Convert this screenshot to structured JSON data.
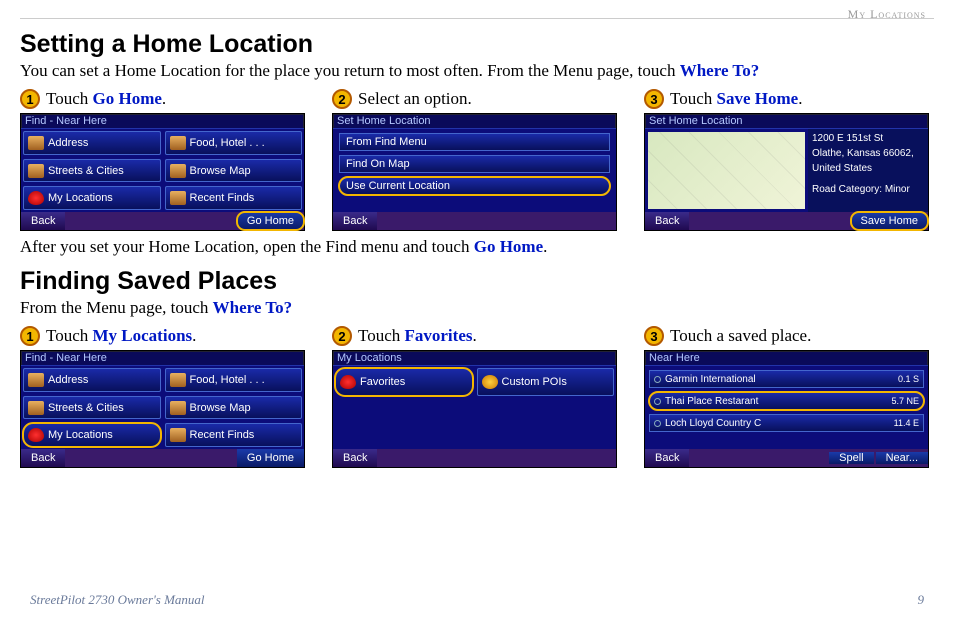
{
  "header": {
    "section": "My Locations"
  },
  "section1": {
    "heading": "Setting a Home Location",
    "intro_plain": "You can set a Home Location for the place you return to most often. From the Menu page, touch ",
    "intro_link": "Where To?",
    "steps": [
      {
        "num": "1",
        "pre": "Touch ",
        "link": "Go Home",
        "post": "."
      },
      {
        "num": "2",
        "pre": "Select an option.",
        "link": "",
        "post": ""
      },
      {
        "num": "3",
        "pre": "Touch ",
        "link": "Save Home",
        "post": "."
      }
    ],
    "devices": {
      "a": {
        "title": "Find - Near Here",
        "left": [
          "Address",
          "Streets & Cities",
          "My Locations"
        ],
        "right": [
          "Food, Hotel . . .",
          "Browse Map",
          "Recent Finds"
        ],
        "back": "Back",
        "action": "Go Home"
      },
      "b": {
        "title": "Set Home Location",
        "options": [
          "From Find Menu",
          "Find On Map",
          "Use Current Location"
        ],
        "back": "Back"
      },
      "c": {
        "title": "Set Home Location",
        "addr1": "1200 E 151st St",
        "addr2": "Olathe, Kansas 66062,",
        "addr3": "United States",
        "addr4": "Road Category: Minor",
        "back": "Back",
        "action": "Save Home"
      }
    },
    "after_pre": "After you set your Home Location, open the Find menu and touch ",
    "after_link": "Go Home",
    "after_post": "."
  },
  "section2": {
    "heading": "Finding Saved Places",
    "intro_plain": "From the Menu page, touch ",
    "intro_link": "Where To?",
    "steps": [
      {
        "num": "1",
        "pre": "Touch ",
        "link": "My Locations",
        "post": "."
      },
      {
        "num": "2",
        "pre": "Touch ",
        "link": "Favorites",
        "post": "."
      },
      {
        "num": "3",
        "pre": "Touch a saved place.",
        "link": "",
        "post": ""
      }
    ],
    "devices": {
      "a": {
        "title": "Find - Near Here",
        "left": [
          "Address",
          "Streets & Cities",
          "My Locations"
        ],
        "right": [
          "Food, Hotel . . .",
          "Browse Map",
          "Recent Finds"
        ],
        "back": "Back",
        "action": "Go Home"
      },
      "b": {
        "title": "My Locations",
        "left": [
          "Favorites"
        ],
        "right": [
          "Custom POIs"
        ],
        "back": "Back"
      },
      "c": {
        "title": "Near Here",
        "rows": [
          {
            "name": "Garmin International",
            "dist": "0.1",
            "dir": "S"
          },
          {
            "name": "Thai Place Restarant",
            "dist": "5.7",
            "dir": "NE"
          },
          {
            "name": "Loch Lloyd Country C",
            "dist": "11.4",
            "dir": "E"
          }
        ],
        "back": "Back",
        "spell": "Spell",
        "near": "Near..."
      }
    }
  },
  "footer": {
    "manual": "StreetPilot 2730 Owner's Manual",
    "page": "9"
  }
}
